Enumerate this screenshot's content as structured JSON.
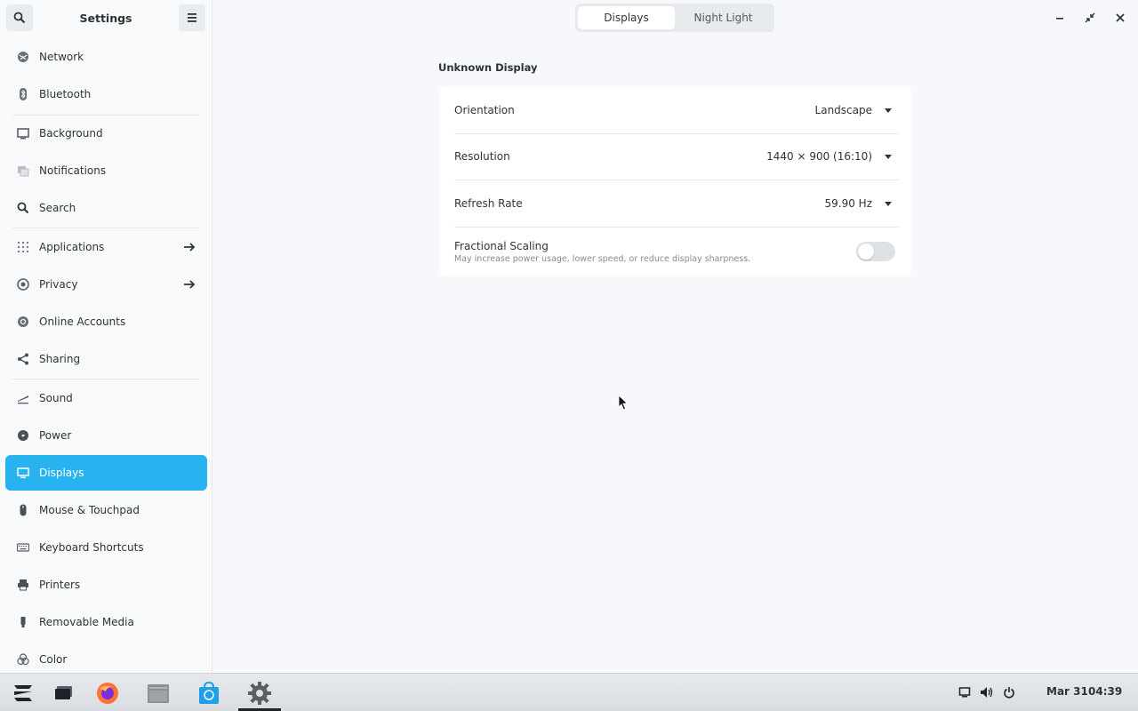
{
  "sidebar": {
    "title": "Settings",
    "items": [
      {
        "label": "Network",
        "icon": "network-icon"
      },
      {
        "label": "Bluetooth",
        "icon": "bluetooth-icon"
      },
      {
        "label": "Background",
        "icon": "background-icon"
      },
      {
        "label": "Notifications",
        "icon": "notifications-icon"
      },
      {
        "label": "Search",
        "icon": "search-icon"
      },
      {
        "label": "Applications",
        "icon": "applications-icon",
        "arrow": true
      },
      {
        "label": "Privacy",
        "icon": "privacy-icon",
        "arrow": true
      },
      {
        "label": "Online Accounts",
        "icon": "online-accounts-icon"
      },
      {
        "label": "Sharing",
        "icon": "sharing-icon"
      },
      {
        "label": "Sound",
        "icon": "sound-icon"
      },
      {
        "label": "Power",
        "icon": "power-icon"
      },
      {
        "label": "Displays",
        "icon": "displays-icon",
        "active": true
      },
      {
        "label": "Mouse & Touchpad",
        "icon": "mouse-icon"
      },
      {
        "label": "Keyboard Shortcuts",
        "icon": "keyboard-icon"
      },
      {
        "label": "Printers",
        "icon": "printer-icon"
      },
      {
        "label": "Removable Media",
        "icon": "removable-media-icon"
      },
      {
        "label": "Color",
        "icon": "color-icon"
      }
    ]
  },
  "header": {
    "tabs": [
      {
        "label": "Displays",
        "active": true
      },
      {
        "label": "Night Light",
        "active": false
      }
    ]
  },
  "main": {
    "section_title": "Unknown Display",
    "rows": {
      "orientation": {
        "label": "Orientation",
        "value": "Landscape"
      },
      "resolution": {
        "label": "Resolution",
        "value": "1440 × 900 (16:10)"
      },
      "refresh_rate": {
        "label": "Refresh Rate",
        "value": "59.90 Hz"
      },
      "fractional_scaling": {
        "label": "Fractional Scaling",
        "description": "May increase power usage, lower speed, or reduce display sharpness.",
        "enabled": false
      }
    }
  },
  "taskbar": {
    "date": "Mar 31",
    "time": "04:39"
  },
  "colors": {
    "accent": "#28b2ef",
    "background": "#f6f8fb",
    "panel": "#ffffff"
  }
}
